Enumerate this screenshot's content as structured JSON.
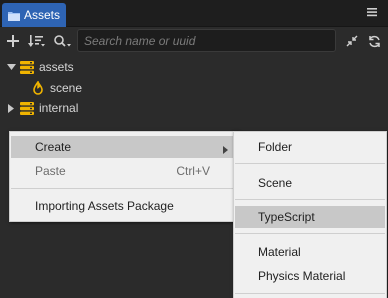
{
  "panel": {
    "tab_title": "Assets",
    "menu_icon": "hamburger-icon"
  },
  "toolbar": {
    "add_icon": "plus-icon",
    "sort_icon": "sort-icon",
    "search_type_icon": "magnifier-dropdown-icon",
    "search_placeholder": "Search name or uuid",
    "collapse_icon": "collapse-icon",
    "refresh_icon": "refresh-icon"
  },
  "tree": {
    "items": [
      {
        "label": "assets",
        "icon": "database-icon",
        "expanded": true
      },
      {
        "label": "scene",
        "icon": "scene-icon"
      },
      {
        "label": "internal",
        "icon": "database-icon",
        "expanded": false
      }
    ]
  },
  "context_menu": {
    "items": [
      {
        "label": "Create",
        "has_submenu": true,
        "highlighted": true
      },
      {
        "label": "Paste",
        "shortcut": "Ctrl+V",
        "disabled": true
      },
      {
        "label": "Importing Assets Package"
      }
    ]
  },
  "submenu": {
    "items": [
      {
        "label": "Folder"
      },
      {
        "label": "Scene"
      },
      {
        "label": "TypeScript",
        "highlighted": true
      },
      {
        "label": "Material"
      },
      {
        "label": "Physics Material"
      }
    ]
  },
  "colors": {
    "tab_active": "#2e64b4",
    "folder_icon": "#f0b400",
    "menu_bg": "#f0f0f0",
    "menu_highlight": "#c8c8c8"
  }
}
